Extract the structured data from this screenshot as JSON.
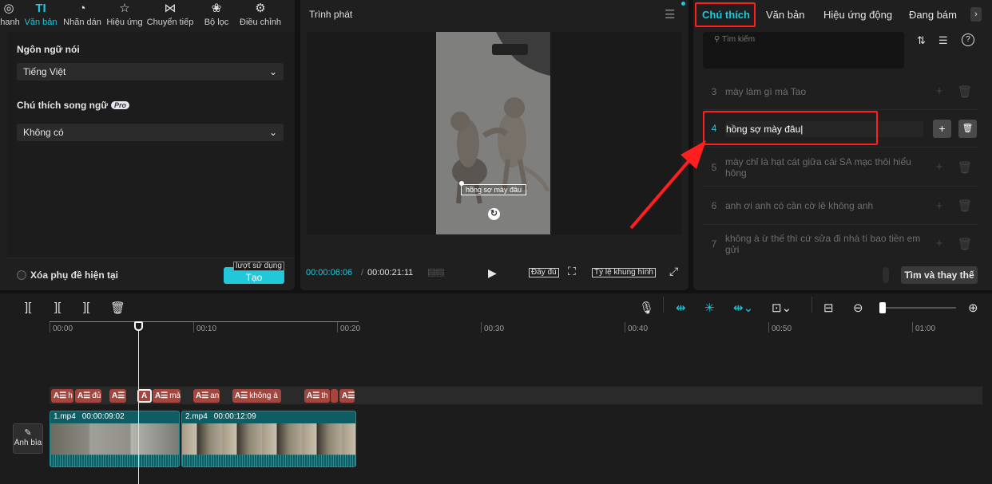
{
  "left_panel": {
    "tabs": [
      {
        "icon": "audio-icon",
        "label": "thanh"
      },
      {
        "icon": "text-icon",
        "label": "Văn bản",
        "active": true
      },
      {
        "icon": "sticker-icon",
        "label": "Nhãn dán"
      },
      {
        "icon": "effects-icon",
        "label": "Hiệu ứng"
      },
      {
        "icon": "transition-icon",
        "label": "Chuyển tiếp"
      },
      {
        "icon": "filter-icon",
        "label": "Bộ lọc"
      },
      {
        "icon": "adjust-icon",
        "label": "Điều chỉnh"
      }
    ],
    "spoken_language_label": "Ngôn ngữ nói",
    "spoken_language_value": "Tiếng Việt",
    "bilingual_label": "Chú thích song ngữ",
    "pro_badge": "Pro",
    "bilingual_value": "Không có",
    "clear_current_label": "Xóa phụ đề hiện tại",
    "tooltip": "lượt sử dụng",
    "create_label": "Tạo"
  },
  "player": {
    "title": "Trình phát",
    "video_subtitle": "hồng sợ mày đâu",
    "time_current": "00:00:06:06",
    "time_separator": "/",
    "time_total": "00:00:21:11",
    "full_label": "Đầy đủ",
    "ratio_label": "Tỷ lệ khung hình"
  },
  "right_panel": {
    "tabs": [
      "Chú thích",
      "Văn bản",
      "Hiệu ứng động",
      "Đang bám"
    ],
    "search_placeholder": "Tìm kiếm",
    "rows": [
      {
        "num": "3",
        "text": "mày làm gì mà Tao"
      },
      {
        "num": "4",
        "text": "hồng sợ mày đâu"
      },
      {
        "num": "5",
        "text": "mày chỉ là hạt cát giữa cái SA mạc thôi hiểu hông"
      },
      {
        "num": "6",
        "text": "anh ơi anh có cần cờ lê không anh"
      },
      {
        "num": "7",
        "text": "không à ừ thế thì cứ sửa đi nhá tí bao tiền em gửi"
      }
    ],
    "find_replace_label": "Tìm và thay thế"
  },
  "timeline": {
    "ruler": [
      "00:00",
      "00:10",
      "00:20",
      "00:30",
      "00:40",
      "00:50",
      "01:00"
    ],
    "caption_clips": [
      {
        "label": "h"
      },
      {
        "label": "đủ"
      },
      {
        "label": ""
      },
      {
        "label": ""
      },
      {
        "label": "mà"
      },
      {
        "label": "an"
      },
      {
        "label": "không à"
      },
      {
        "label": "th"
      },
      {
        "label": ""
      }
    ],
    "video_clips": [
      {
        "name": "1.mp4",
        "duration": "00:00:09:02"
      },
      {
        "name": "2.mp4",
        "duration": "00:00:12:09"
      }
    ],
    "cover_label": "Ảnh bìa"
  },
  "colors": {
    "accent": "#22c7d9",
    "annotation_red": "#ff1f1f",
    "caption_clip": "#a5463e",
    "video_clip": "#0e5d63"
  }
}
